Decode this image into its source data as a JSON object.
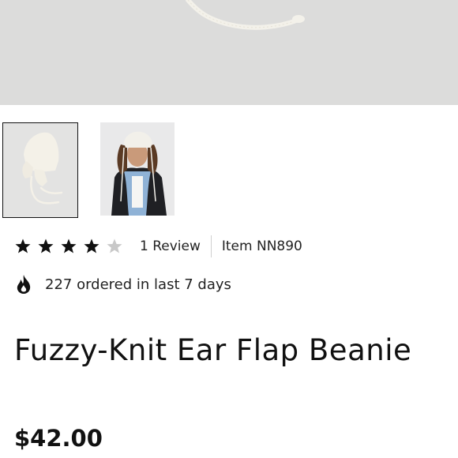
{
  "product": {
    "title": "Fuzzy-Knit Ear Flap Beanie",
    "price": "$42.00",
    "rating": {
      "value": 4,
      "max": 5,
      "reviews_label": "1 Review"
    },
    "item_number": "Item NN890",
    "ordered_text": "227 ordered in last 7 days"
  },
  "gallery": {
    "thumbnails": [
      {
        "name": "beanie-product-photo",
        "selected": true
      },
      {
        "name": "beanie-model-photo",
        "selected": false
      }
    ]
  },
  "icons": {
    "star": "star-icon",
    "fire": "fire-icon"
  },
  "colors": {
    "star_filled": "#111111",
    "star_empty": "#c8c8c8",
    "hero_bg": "#dcdcdb"
  }
}
